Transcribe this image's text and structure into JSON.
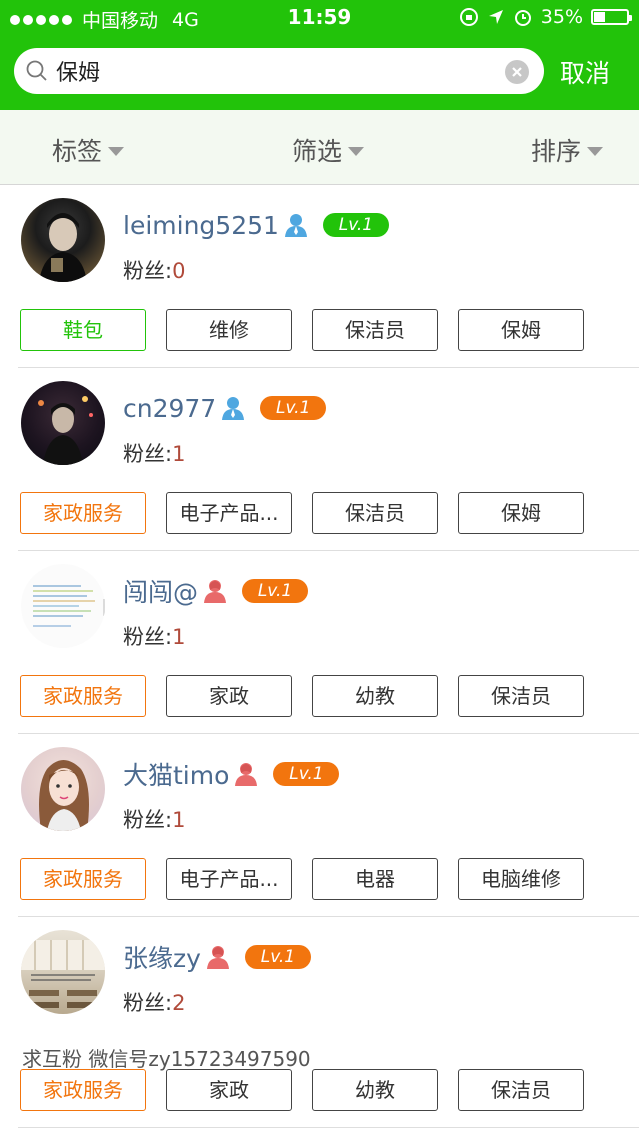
{
  "status_bar": {
    "carrier": "中国移动",
    "network": "4G",
    "time": "11:59",
    "battery": "35%"
  },
  "search": {
    "value": "保姆",
    "cancel_label": "取消"
  },
  "filters": [
    {
      "label": "标签"
    },
    {
      "label": "筛选"
    },
    {
      "label": "排序"
    }
  ],
  "users": [
    {
      "name": "leiming5251",
      "gender": "male",
      "level": "Lv.1",
      "level_color": "green",
      "fans_label": "粉丝:",
      "fans_count": "0",
      "bio": "",
      "tags": [
        "鞋包",
        "维修",
        "保洁员",
        "保姆"
      ]
    },
    {
      "name": "cn2977",
      "gender": "male",
      "level": "Lv.1",
      "level_color": "orange",
      "fans_label": "粉丝:",
      "fans_count": "1",
      "bio": "",
      "tags": [
        "家政服务",
        "电子产品...",
        "保洁员",
        "保姆"
      ]
    },
    {
      "name": "闯闯@",
      "gender": "female",
      "level": "Lv.1",
      "level_color": "orange",
      "fans_label": "粉丝:",
      "fans_count": "1",
      "bio": "",
      "tags": [
        "家政服务",
        "家政",
        "幼教",
        "保洁员"
      ]
    },
    {
      "name": "大猫timo",
      "gender": "female",
      "level": "Lv.1",
      "level_color": "orange",
      "fans_label": "粉丝:",
      "fans_count": "1",
      "bio": "",
      "tags": [
        "家政服务",
        "电子产品...",
        "电器",
        "电脑维修"
      ]
    },
    {
      "name": "张缘zy",
      "gender": "female",
      "level": "Lv.1",
      "level_color": "orange",
      "fans_label": "粉丝:",
      "fans_count": "2",
      "bio": "求互粉  微信号zy15723497590",
      "tags": [
        "家政服务",
        "家政",
        "幼教",
        "保洁员"
      ]
    }
  ],
  "colors": {
    "brand_green": "#22c30a",
    "level_orange": "#f2750e",
    "male_icon": "#4fa7e0",
    "female_icon": "#e86a6a"
  }
}
